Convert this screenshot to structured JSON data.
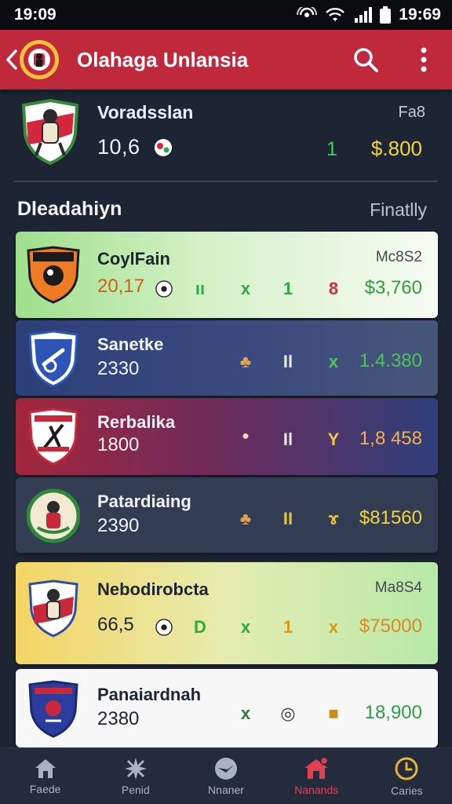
{
  "status_bar": {
    "time_left": "19:09",
    "time_right": "19:69"
  },
  "app_bar": {
    "title": "Olahaga Unlansia"
  },
  "featured": {
    "name": "Voradsslan",
    "score": "10,6",
    "stat": "1",
    "price": "$.800",
    "corner": "Fa8"
  },
  "section": {
    "title": "Dleadahiyn",
    "filter": "Finatlly"
  },
  "rows": [
    {
      "name": "CoylFain",
      "value": "20,17",
      "c1": "ıı",
      "c2": "x",
      "c3": "1",
      "c4": "8",
      "price": "$3,760",
      "corner": "Mc8S2"
    },
    {
      "name": "Sanetke",
      "value": "2330",
      "c1": "",
      "c2": "♣",
      "c3": "Il",
      "c4": "x",
      "price": "1.4.380",
      "corner": ""
    },
    {
      "name": "Rerbalika",
      "value": "1800",
      "c1": "",
      "c2": "●",
      "c3": "Il",
      "c4": "Y",
      "price": "1,8 458",
      "corner": ""
    },
    {
      "name": "Patardiaing",
      "value": "2390",
      "c1": "",
      "c2": "♣",
      "c3": "II",
      "c4": "ɤ",
      "price": "$81560",
      "corner": ""
    },
    {
      "name": "Nebodirobcta",
      "value": "66,5",
      "c1": "D",
      "c2": "x",
      "c3": "1",
      "c4": "x",
      "price": "$75000",
      "corner": "Ma8S4"
    },
    {
      "name": "Panaiardnah",
      "value": "2380",
      "c1": "",
      "c2": "x",
      "c3": "◎",
      "c4": "■",
      "price": "18,900",
      "corner": ""
    }
  ],
  "bottom_nav": [
    {
      "label": "Faede",
      "icon": "home-icon"
    },
    {
      "label": "Penid",
      "icon": "sparkle-icon"
    },
    {
      "label": "Nnaner",
      "icon": "bird-icon"
    },
    {
      "label": "Nanands",
      "icon": "stadium-icon"
    },
    {
      "label": "Caries",
      "icon": "clock-icon"
    }
  ],
  "colors": {
    "app_bar": "#c0283b",
    "background": "#1d2433",
    "accent_green": "#2eaa44",
    "accent_yellow": "#f0d63c",
    "active_nav": "#e04150"
  }
}
